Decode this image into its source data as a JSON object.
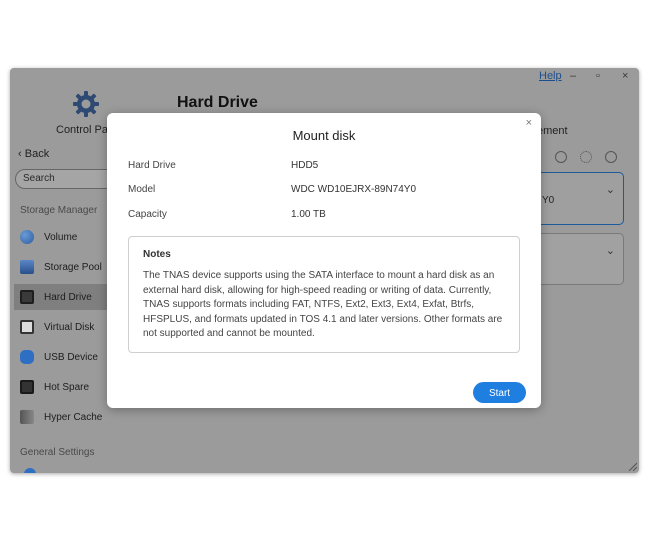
{
  "window": {
    "help_label": "Help",
    "minimize_glyph": "–",
    "maximize_glyph": "▫",
    "close_glyph": "×",
    "control_panel_label": "Control Panel",
    "page_title": "Hard Drive",
    "management_label": "ement"
  },
  "sidebar": {
    "back_label": "Back",
    "search_placeholder": "Search",
    "storage_section": "Storage Manager",
    "items": [
      {
        "label": "Volume",
        "icon": "volume-icon"
      },
      {
        "label": "Storage Pool",
        "icon": "storage-pool-icon"
      },
      {
        "label": "Hard Drive",
        "icon": "hard-drive-icon",
        "active": true
      },
      {
        "label": "Virtual Disk",
        "icon": "virtual-disk-icon"
      },
      {
        "label": "USB Device",
        "icon": "usb-device-icon"
      },
      {
        "label": "Hot Spare",
        "icon": "hot-spare-icon"
      },
      {
        "label": "Hyper Cache",
        "icon": "hyper-cache-icon"
      }
    ],
    "general_section": "General Settings"
  },
  "main": {
    "card1_text": "Y0"
  },
  "modal": {
    "title": "Mount disk",
    "close_glyph": "×",
    "fields": [
      {
        "label": "Hard Drive",
        "value": "HDD5"
      },
      {
        "label": "Model",
        "value": "WDC WD10EJRX-89N74Y0"
      },
      {
        "label": "Capacity",
        "value": "1.00 TB"
      }
    ],
    "notes_title": "Notes",
    "notes_body": "The TNAS device supports using the SATA interface to mount a hard disk as an external hard disk, allowing for high-speed reading or writing of data. Currently, TNAS supports formats including FAT, NTFS, Ext2, Ext3, Ext4, Exfat, Btrfs, HFSPLUS, and formats updated in TOS 4.1 and later versions. Other formats are not supported and cannot be mounted.",
    "start_label": "Start"
  },
  "colors": {
    "accent": "#1e7fe0",
    "overlay": "#9b9b9b",
    "active_card_border": "#1d5a99"
  }
}
